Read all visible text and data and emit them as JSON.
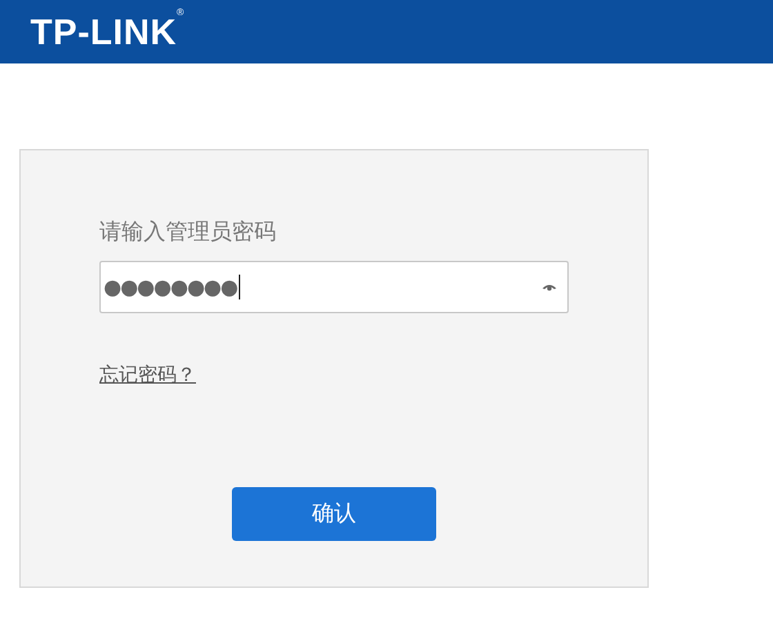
{
  "header": {
    "logo": "TP-LINK$^{®}$"
  },
  "login": {
    "label": "请输入管理员密码",
    "password": "●●●●●●●●",
    "focused": true,
    "forgot_link": "忘记密码？",
    "button": "确认"
  }
}
